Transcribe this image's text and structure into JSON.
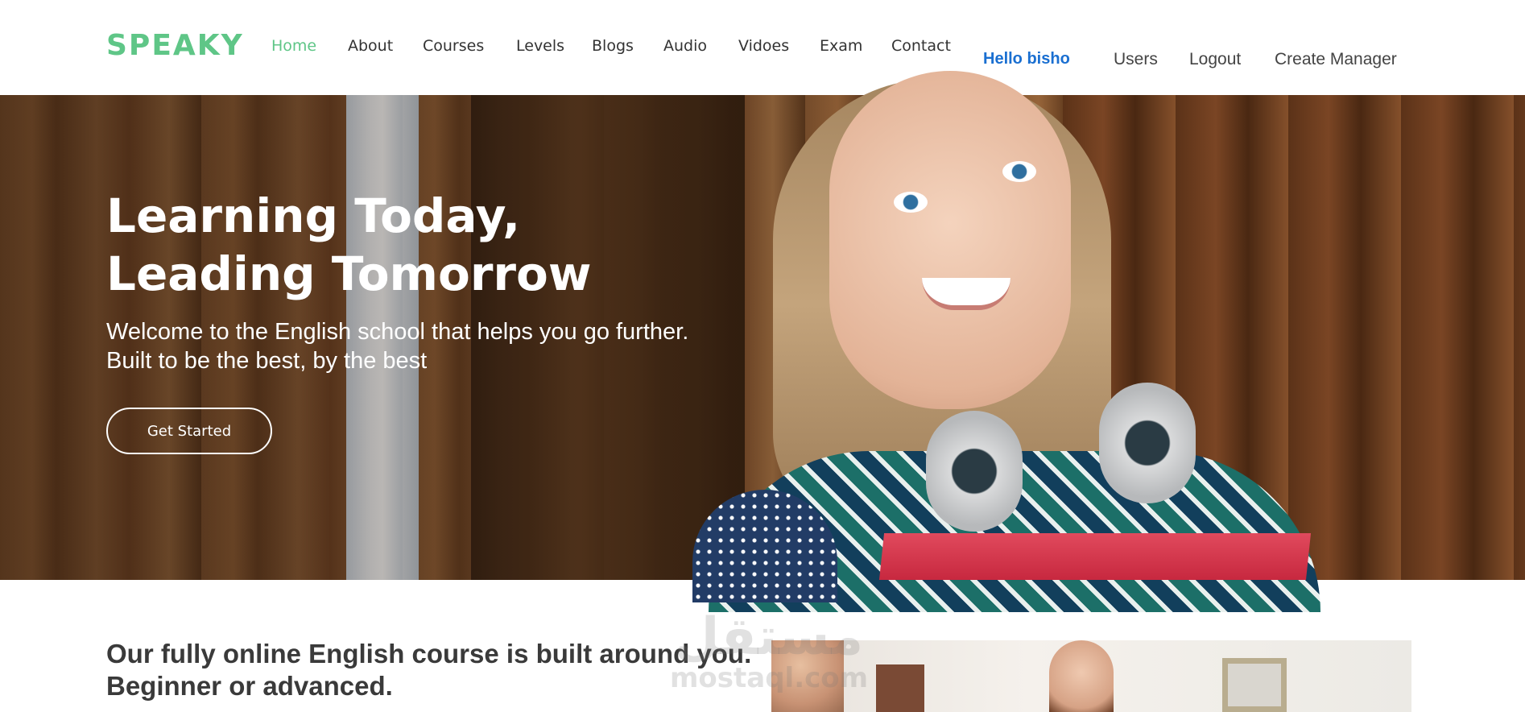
{
  "brand": {
    "logo": "SPEAKY",
    "accent": "#5fc687",
    "link_color": "#1a6fd1"
  },
  "nav": {
    "items": [
      {
        "label": "Home",
        "active": true
      },
      {
        "label": "About"
      },
      {
        "label": "Courses"
      },
      {
        "label": "Levels"
      },
      {
        "label": "Blogs"
      },
      {
        "label": "Audio"
      },
      {
        "label": "Vidoes"
      },
      {
        "label": "Exam"
      },
      {
        "label": "Contact"
      }
    ],
    "greeting": "Hello bisho",
    "users": "Users",
    "logout": "Logout",
    "create_manager": "Create Manager"
  },
  "hero": {
    "title_line1": "Learning Today,",
    "title_line2": "Leading Tomorrow",
    "subtitle_line1": "Welcome to the English school that helps you go further.",
    "subtitle_line2": "Built to be the best, by the best",
    "cta_label": "Get Started"
  },
  "intro": {
    "line1": "Our fully online English course is built around you.",
    "line2": "Beginner or advanced."
  },
  "watermark": {
    "arabic": "مستقل",
    "latin": "mostaql.com"
  }
}
